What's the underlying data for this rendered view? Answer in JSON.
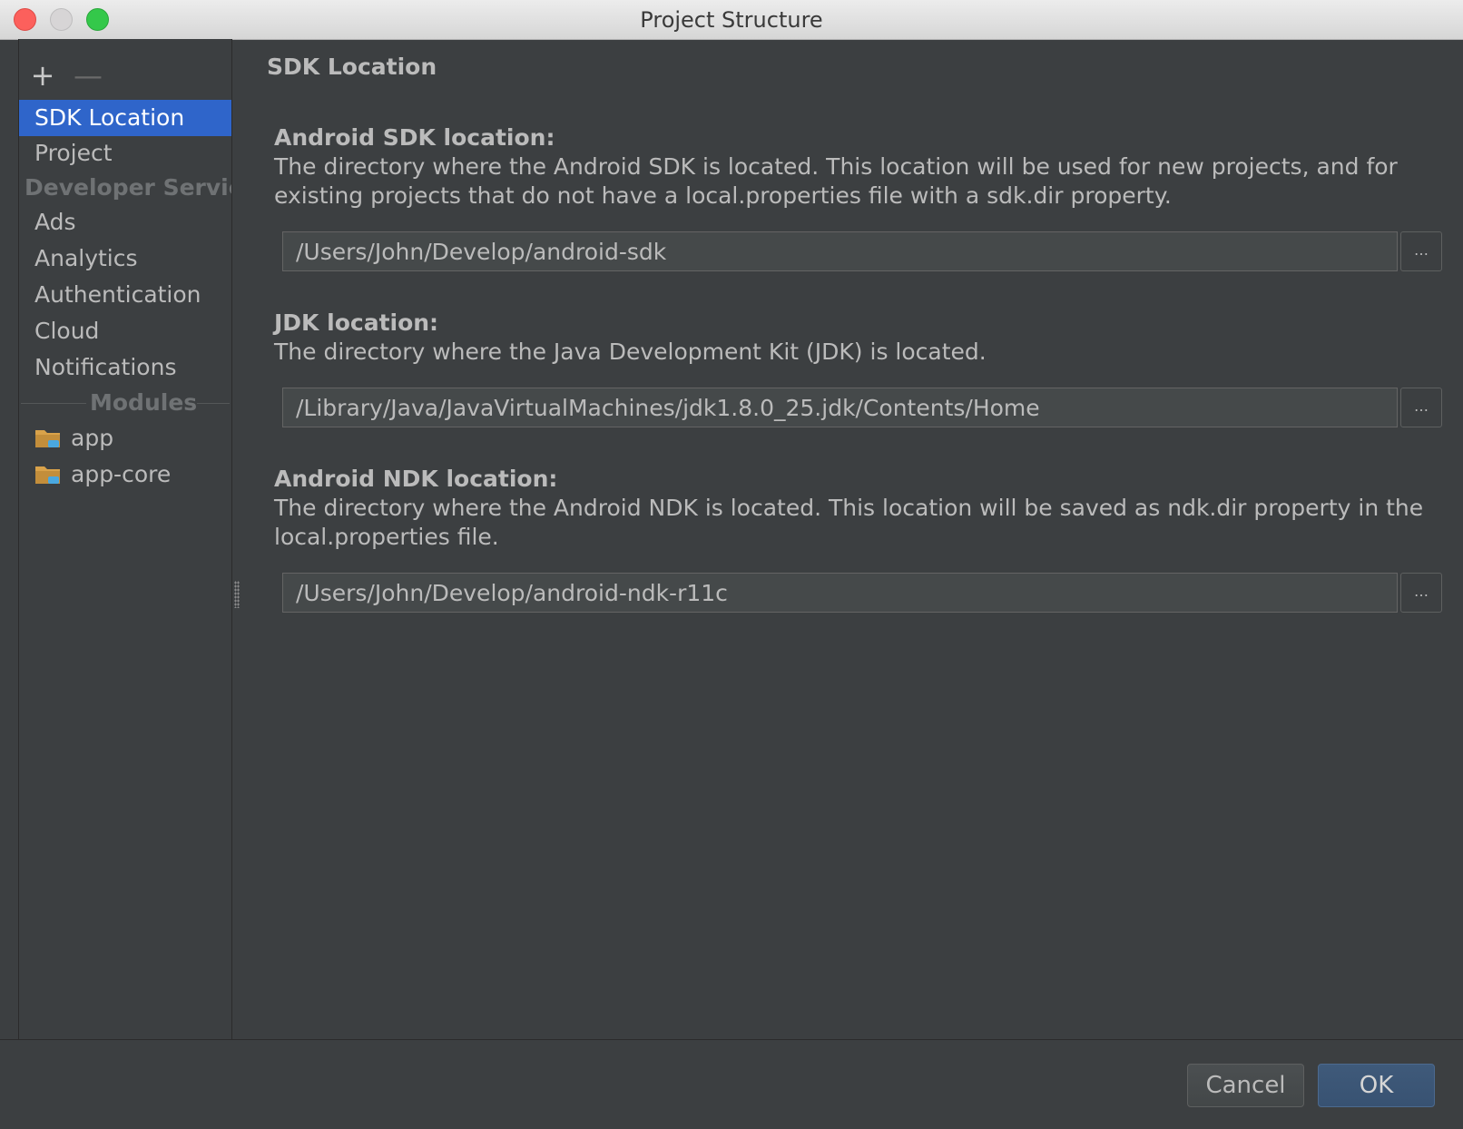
{
  "window": {
    "title": "Project Structure"
  },
  "toolbar": {
    "add": "+",
    "remove": "—"
  },
  "sidebar": {
    "items": [
      {
        "label": "SDK Location",
        "selected": true
      },
      {
        "label": "Project"
      }
    ],
    "developer_services_header": "Developer Servic",
    "developer_services": [
      {
        "label": "Ads"
      },
      {
        "label": "Analytics"
      },
      {
        "label": "Authentication"
      },
      {
        "label": "Cloud"
      },
      {
        "label": "Notifications"
      }
    ],
    "modules_header": "Modules",
    "modules": [
      {
        "label": "app",
        "icon": "module-folder-icon"
      },
      {
        "label": "app-core",
        "icon": "module-folder-icon"
      }
    ]
  },
  "main": {
    "page_title": "SDK Location",
    "sections": [
      {
        "title": "Android SDK location:",
        "description": "The directory where the Android SDK is located. This location will be used for new projects, and for existing projects that do not have a local.properties file with a sdk.dir property.",
        "value": "/Users/John/Develop/android-sdk",
        "browse": "…"
      },
      {
        "title": "JDK location:",
        "description": "The directory where the Java Development Kit (JDK) is located.",
        "value": "/Library/Java/JavaVirtualMachines/jdk1.8.0_25.jdk/Contents/Home",
        "browse": "…"
      },
      {
        "title": "Android NDK location:",
        "description": "The directory where the Android NDK is located. This location will be saved as ndk.dir property in the local.properties file.",
        "value": "/Users/John/Develop/android-ndk-r11c",
        "browse": "…"
      }
    ]
  },
  "buttons": {
    "cancel": "Cancel",
    "ok": "OK"
  },
  "colors": {
    "background": "#3c3f41",
    "selection": "#2f65ca",
    "ok_button": "#385272",
    "folder": "#d9a24a",
    "module_badge": "#4aa8e0"
  }
}
